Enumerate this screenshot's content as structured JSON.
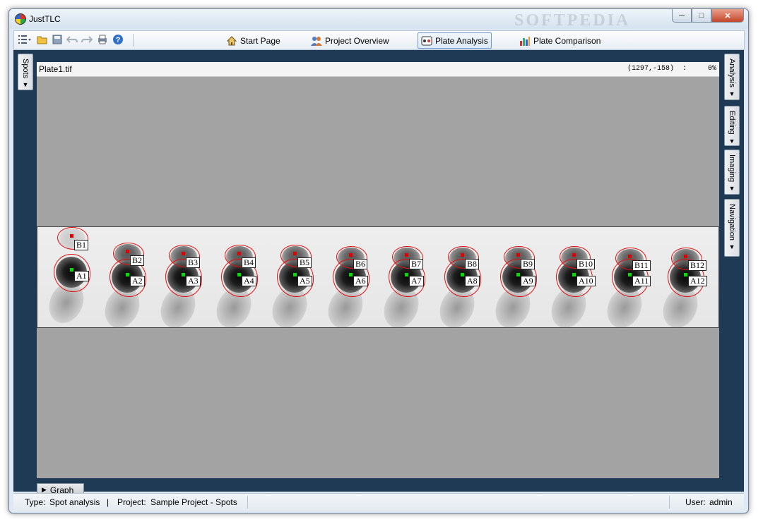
{
  "window": {
    "title": "JustTLC",
    "watermark": "SOFTPEDIA"
  },
  "window_controls": {
    "minimize": "─",
    "maximize": "□",
    "close": "✕"
  },
  "toolbar": {
    "icons": [
      "list-menu-icon",
      "open-folder-icon",
      "save-icon",
      "undo-icon",
      "redo-icon",
      "print-icon",
      "help-icon"
    ],
    "nav": [
      {
        "label": "Start Page",
        "icon": "home-icon"
      },
      {
        "label": "Project Overview",
        "icon": "users-icon"
      },
      {
        "label": "Plate Analysis",
        "icon": "plate-icon",
        "active": true
      },
      {
        "label": "Plate Comparison",
        "icon": "bar-chart-icon"
      }
    ]
  },
  "left_panel": {
    "spots_tab": "Spots"
  },
  "right_panel": {
    "tabs": [
      "Analysis",
      "Editing",
      "Imaging",
      "Navigation"
    ]
  },
  "plate_view": {
    "filename": "Plate1.tif",
    "coords": "(1297,-158)  :     0%"
  },
  "spots": [
    {
      "lane": 1,
      "upper": "B1",
      "lower": "A1"
    },
    {
      "lane": 2,
      "upper": "B2",
      "lower": "A2"
    },
    {
      "lane": 3,
      "upper": "B3",
      "lower": "A3"
    },
    {
      "lane": 4,
      "upper": "B4",
      "lower": "A4"
    },
    {
      "lane": 5,
      "upper": "B5",
      "lower": "A5"
    },
    {
      "lane": 6,
      "upper": "B6",
      "lower": "A6"
    },
    {
      "lane": 7,
      "upper": "B7",
      "lower": "A7"
    },
    {
      "lane": 8,
      "upper": "B8",
      "lower": "A8"
    },
    {
      "lane": 9,
      "upper": "B9",
      "lower": "A9"
    },
    {
      "lane": 10,
      "upper": "B10",
      "lower": "A10"
    },
    {
      "lane": 11,
      "upper": "B11",
      "lower": "A11"
    },
    {
      "lane": 12,
      "upper": "B12",
      "lower": "A12"
    }
  ],
  "graph_panel": {
    "label": "Graph"
  },
  "status": {
    "type_label": "Type:",
    "type_value": "Spot analysis",
    "separator": "|",
    "project_label": "Project:",
    "project_value": "Sample Project - Spots",
    "user_label": "User:",
    "user_value": "admin"
  },
  "colors": {
    "workspace_bg": "#1e3a55",
    "canvas_bg": "#a3a3a3",
    "spot_outline": "#e01010",
    "marker_upper": "#e00000",
    "marker_lower": "#00e000"
  }
}
